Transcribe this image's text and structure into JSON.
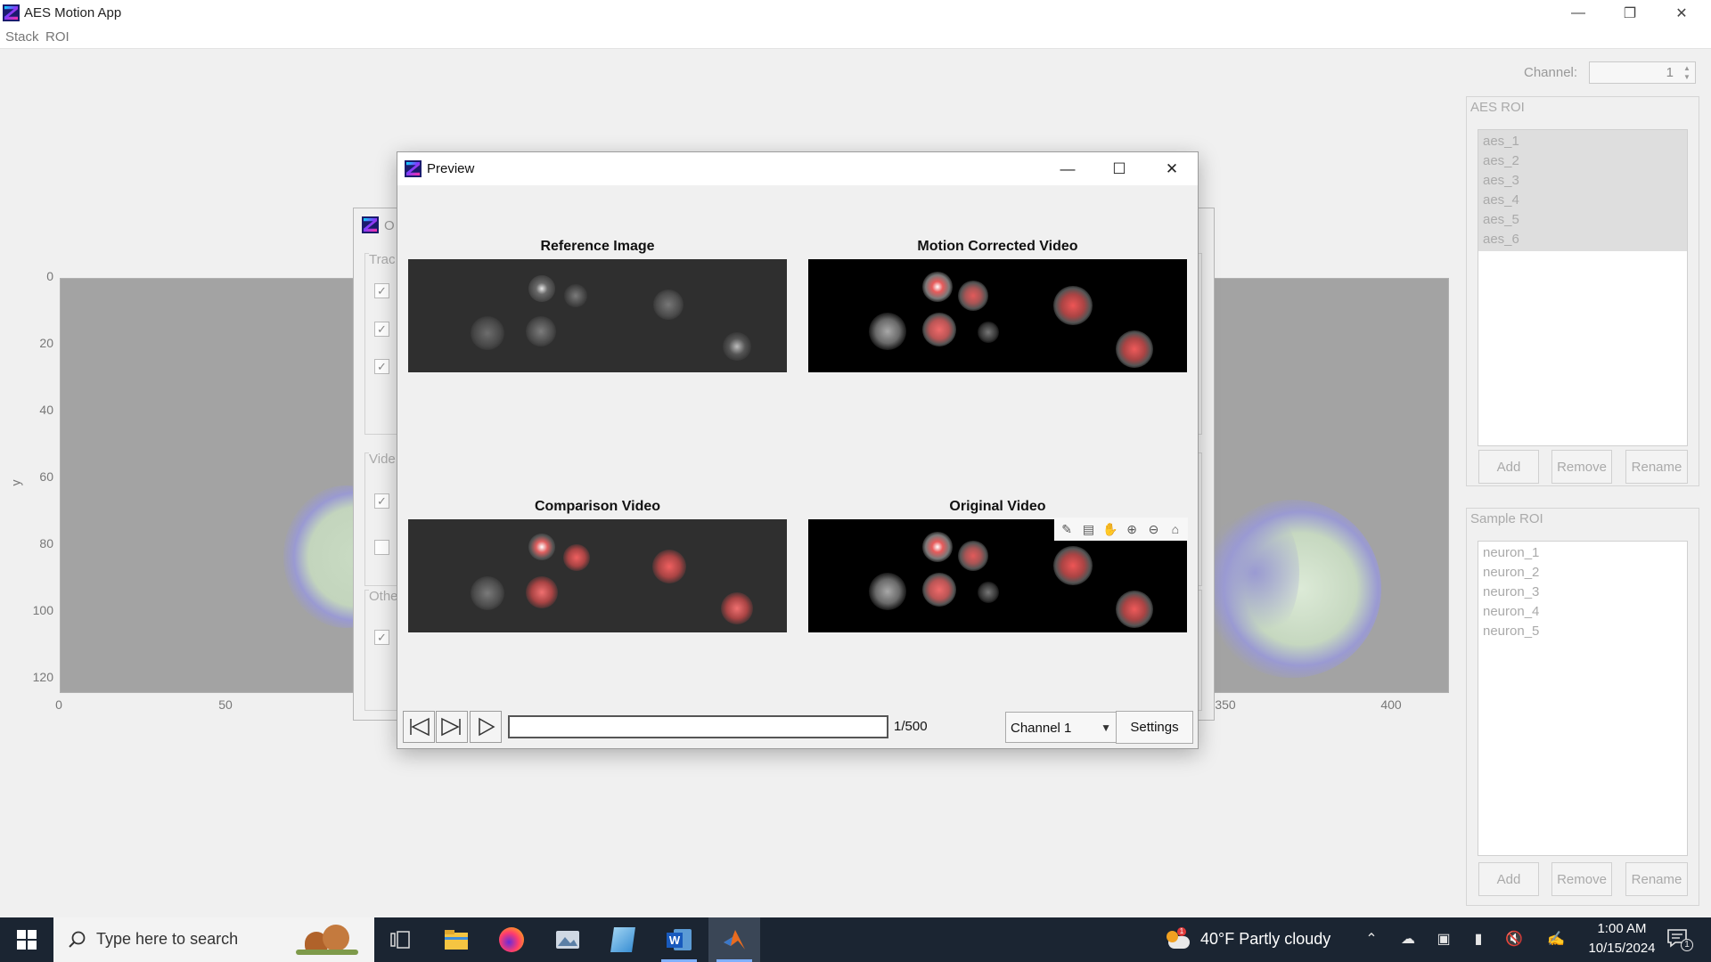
{
  "app": {
    "title": "AES Motion App",
    "menu": [
      "Stack",
      "ROI"
    ]
  },
  "main_plot": {
    "y_ticks": [
      "0",
      "20",
      "40",
      "60",
      "80",
      "100",
      "120"
    ],
    "x_ticks": [
      "0",
      "50",
      "350",
      "400"
    ],
    "y_label": "y"
  },
  "channel_control": {
    "label": "Channel:",
    "value": "1"
  },
  "aes_roi": {
    "title": "AES ROI",
    "items": [
      "aes_1",
      "aes_2",
      "aes_3",
      "aes_4",
      "aes_5",
      "aes_6"
    ],
    "buttons": {
      "add": "Add",
      "remove": "Remove",
      "rename": "Rename"
    }
  },
  "sample_roi": {
    "title": "Sample ROI",
    "items": [
      "neuron_1",
      "neuron_2",
      "neuron_3",
      "neuron_4",
      "neuron_5"
    ],
    "buttons": {
      "add": "Add",
      "remove": "Remove",
      "rename": "Rename"
    }
  },
  "background_dialog": {
    "title_fragment": "O",
    "groups": [
      "Trac",
      "Vide",
      "Othe"
    ]
  },
  "preview": {
    "title": "Preview",
    "panels": {
      "reference": "Reference Image",
      "motion_corrected": "Motion Corrected Video",
      "comparison": "Comparison Video",
      "original": "Original Video"
    },
    "frame_counter": "1/500",
    "progress": 0,
    "channel_select": "Channel 1",
    "settings_label": "Settings"
  },
  "taskbar": {
    "search_placeholder": "Type here to search",
    "weather": "40°F  Partly cloudy",
    "time": "1:00 AM",
    "date": "10/15/2024",
    "notification_count": "1"
  }
}
